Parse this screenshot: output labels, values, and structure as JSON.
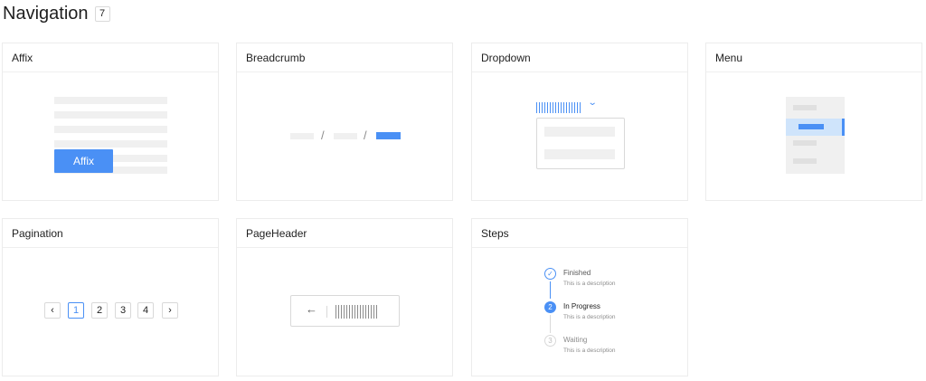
{
  "header": {
    "title": "Navigation",
    "count": "7"
  },
  "cards": {
    "affix": {
      "title": "Affix",
      "button_label": "Affix"
    },
    "breadcrumb": {
      "title": "Breadcrumb",
      "separator": "/"
    },
    "dropdown": {
      "title": "Dropdown",
      "chevron_icon": "chevron-down-icon"
    },
    "menu": {
      "title": "Menu"
    },
    "pagination": {
      "title": "Pagination",
      "pages": [
        "1",
        "2",
        "3",
        "4"
      ],
      "active_page": "1",
      "prev_icon": "‹",
      "next_icon": "›"
    },
    "pageheader": {
      "title": "PageHeader",
      "back_icon": "←"
    },
    "steps": {
      "title": "Steps",
      "items": [
        {
          "marker": "✓",
          "title": "Finished",
          "description": "This is a description",
          "status": "finished"
        },
        {
          "marker": "2",
          "title": "In Progress",
          "description": "This is a description",
          "status": "process"
        },
        {
          "marker": "3",
          "title": "Waiting",
          "description": "This is a description",
          "status": "wait"
        }
      ]
    }
  },
  "colors": {
    "accent": "#4a90f5",
    "accent_light": "#cfe4fb",
    "placeholder": "#f0f0f0",
    "border": "#d9d9d9"
  }
}
